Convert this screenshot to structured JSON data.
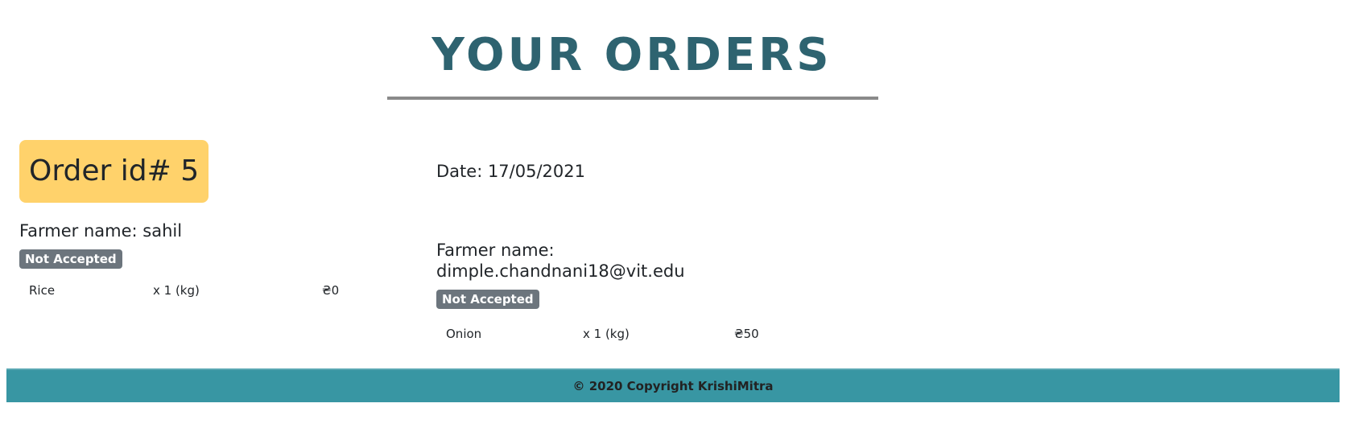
{
  "header": {
    "title": "YOUR ORDERS"
  },
  "orders": [
    {
      "heading": "Order id# 5",
      "farmer": "Farmer name: sahil",
      "status": "Not Accepted",
      "items": [
        {
          "name": "Rice",
          "qty": "x 1 (kg)",
          "price": "₴0"
        }
      ]
    },
    {
      "heading": "Date: 17/05/2021",
      "farmer_label": "Farmer name:",
      "farmer_value": "dimple.chandnani18@vit.edu",
      "status": "Not Accepted",
      "items": [
        {
          "name": "Onion",
          "qty": "x 1 (kg)",
          "price": "₴50"
        }
      ]
    }
  ],
  "footer": {
    "text": "© 2020 Copyright KrishiMitra"
  },
  "colors": {
    "title": "#2e6370",
    "badge": "#6c757d",
    "order_id_bg": "#ffd26b",
    "footer": "#3896a3"
  }
}
